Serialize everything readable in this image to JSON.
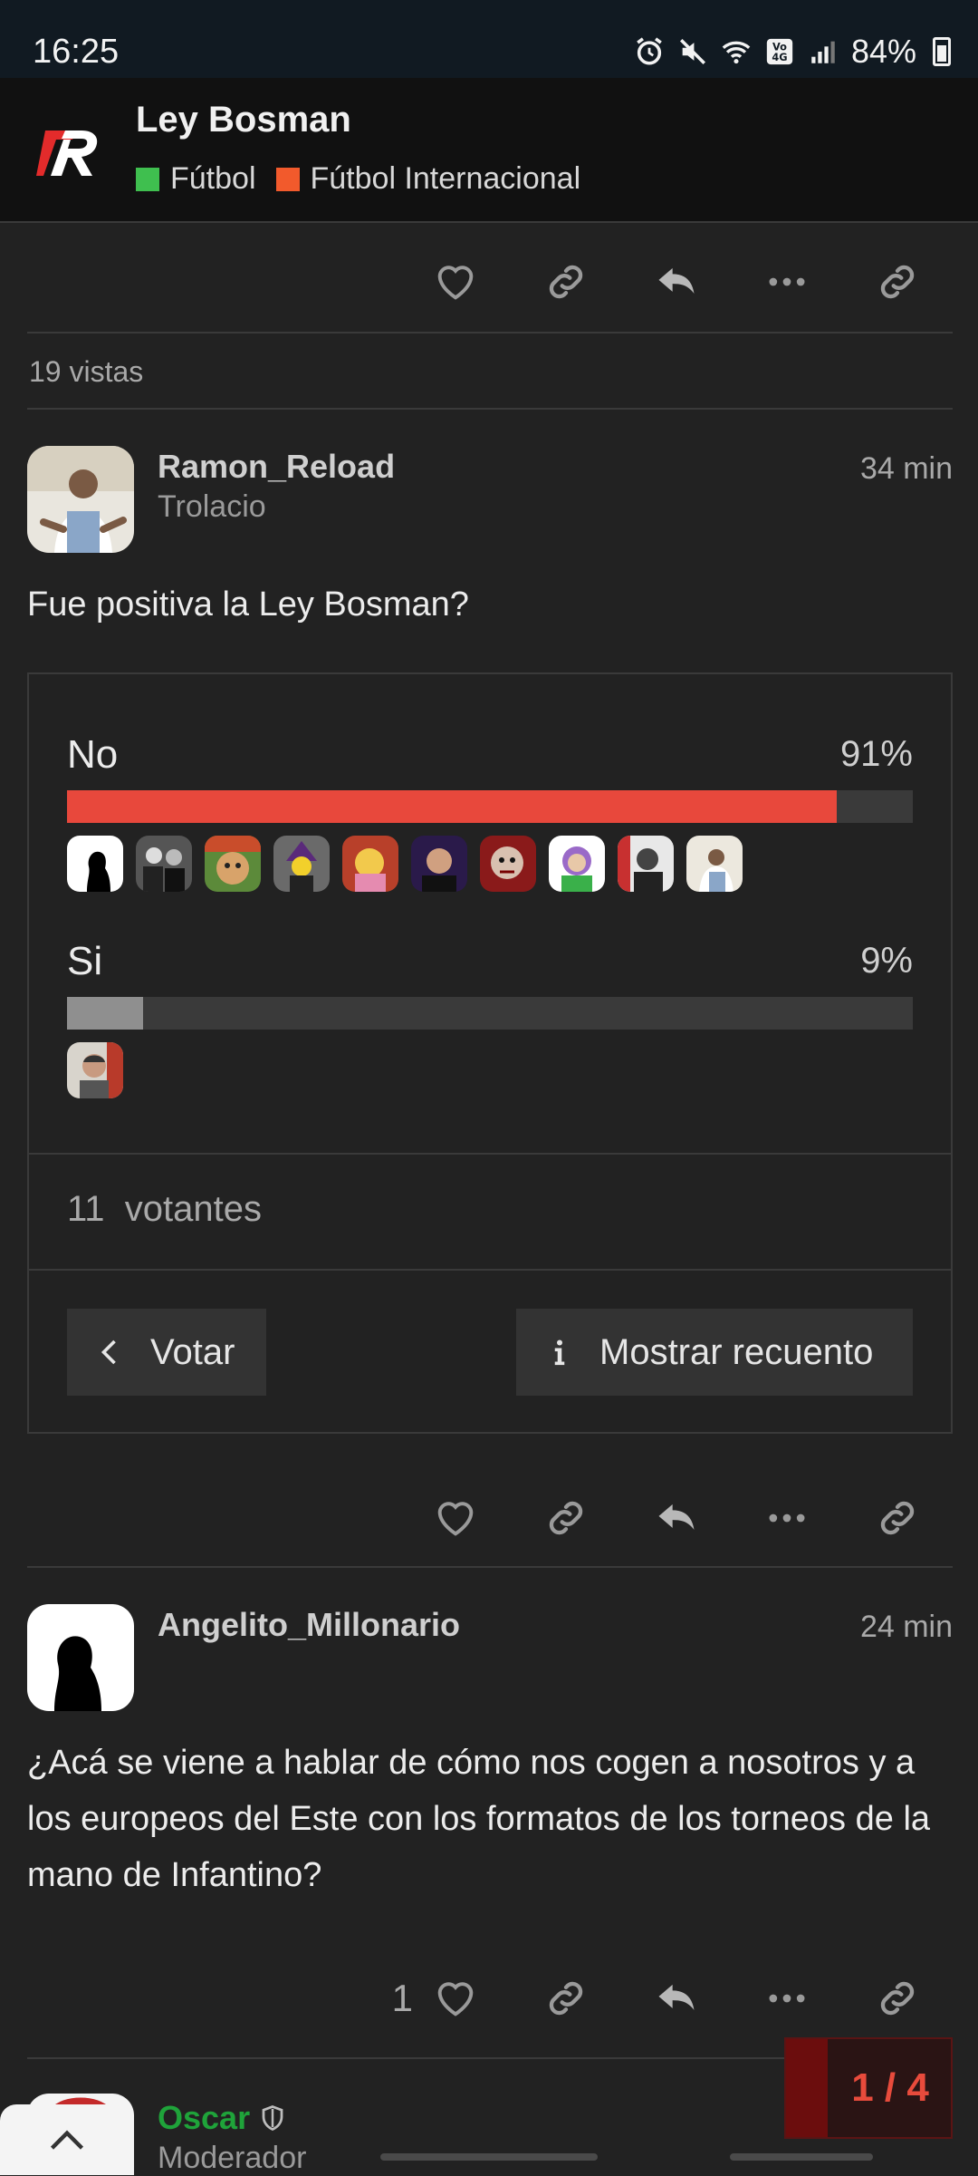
{
  "status_bar": {
    "time": "16:25",
    "battery": "84%",
    "icons": [
      "alarm-icon",
      "mute-icon",
      "wifi-icon",
      "volte-icon",
      "signal-icon",
      "battery-icon"
    ]
  },
  "header": {
    "title": "Ley Bosman",
    "categories": [
      {
        "label": "Fútbol",
        "color": "#3fbf4f"
      },
      {
        "label": "Fútbol Internacional",
        "color": "#f25a2c"
      }
    ]
  },
  "post_actions": {
    "icons": [
      "heart-icon",
      "link-icon",
      "reply-icon",
      "more-icon",
      "link-icon"
    ]
  },
  "views": "19 vistas",
  "post1": {
    "username": "Ramon_Reload",
    "user_title": "Trolacio",
    "time": "34 min",
    "text": "Fue positiva la Ley Bosman?",
    "poll": {
      "options": [
        {
          "label": "No",
          "percent_label": "91%",
          "fraction": 0.91,
          "color": "#e8483c",
          "voter_count": 10
        },
        {
          "label": "Si",
          "percent_label": "9%",
          "fraction": 0.09,
          "color": "#8f8f8f",
          "voter_count": 1
        }
      ],
      "voters_number": "11",
      "voters_label": "votantes",
      "vote_button": "Votar",
      "show_results_button": "Mostrar recuento"
    }
  },
  "post2": {
    "username": "Angelito_Millonario",
    "time": "24 min",
    "text": "¿Acá se viene a hablar de cómo nos cogen a nosotros y a los europeos del Este con los formatos de los torneos de la mano de Infantino?",
    "like_count": "1"
  },
  "post3": {
    "username": "Oscar",
    "user_title": "Moderador",
    "username_color": "#1fa33a"
  },
  "progress": {
    "label": "1 / 4",
    "current": 1,
    "total": 4
  },
  "colors": {
    "accent": "#e84b3c",
    "background": "#222222"
  }
}
